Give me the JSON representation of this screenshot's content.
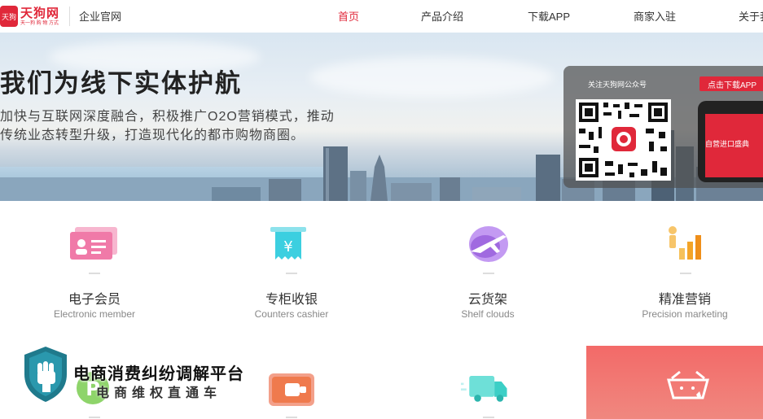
{
  "header": {
    "logo_name": "天狗网",
    "logo_mark": "天狗",
    "logo_sub": "天一狗 购 物 方式",
    "site_label": "企业官网",
    "nav": [
      {
        "label": "首页",
        "active": true
      },
      {
        "label": "产品介绍"
      },
      {
        "label": "下载APP"
      },
      {
        "label": "商家入驻"
      },
      {
        "label": "关于我"
      }
    ]
  },
  "banner": {
    "headline": "我们为线下实体护航",
    "subline_1": "加快与互联网深度融合，积极推广O2O营销模式，推动",
    "subline_2": "传统业态转型升级，打造现代化的都市购物商圈。",
    "follow_label": "关注天狗网公众号",
    "download_button": "点击下载APP",
    "phone_promo": "自营进口盛典"
  },
  "features": [
    {
      "title": "电子会员",
      "en": "Electronic member",
      "icon": "member-card-icon"
    },
    {
      "title": "专柜收银",
      "en": "Counters cashier",
      "icon": "cashier-receipt-icon"
    },
    {
      "title": "云货架",
      "en": "Shelf clouds",
      "icon": "cloud-plane-icon"
    },
    {
      "title": "精准营销",
      "en": "Precision marketing",
      "icon": "marketing-chart-icon"
    }
  ],
  "features_row2": [
    {
      "icon": "parking-p-icon"
    },
    {
      "icon": "wallet-icon"
    },
    {
      "icon": "delivery-truck-icon"
    },
    {
      "icon": "shopping-basket-icon"
    }
  ],
  "watermark": {
    "title": "电商消费纠纷调解平台",
    "subtitle": "电商维权直通车"
  },
  "colors": {
    "brand_red": "#e0283a",
    "member_pink": "#f07aa8",
    "cashier_cyan": "#3ccfe0",
    "cloud_purple": "#a06ae0",
    "marketing_orange": "#f3a428"
  }
}
